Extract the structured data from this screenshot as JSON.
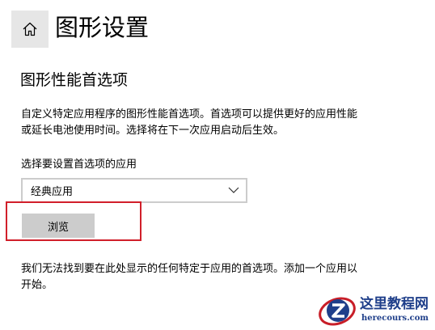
{
  "header": {
    "home_icon": "home-icon",
    "title": "图形设置"
  },
  "section": {
    "heading": "图形性能首选项",
    "description_lines": [
      "自定义特定应用程序的图形性能首选项。首选项可以提供更好的应用性能",
      "或延长电池使用时间。选择将在下一次应用启动后生效。"
    ]
  },
  "app_picker": {
    "label": "选择要设置首选项的应用",
    "selected": "经典应用",
    "chevron_icon": "chevron-down-icon"
  },
  "browse_button": {
    "label": "浏览"
  },
  "empty_message_lines": [
    "我们无法找到要在此处显示的任何特定于应用的首选项。添加一个应用以",
    "开始。"
  ],
  "watermark": {
    "name": "这里教程网",
    "url": "herecours.com"
  },
  "colors": {
    "highlight_border": "#d11f2a",
    "button_bg": "#cccccc",
    "home_bg": "#e6e6e6",
    "watermark_blue": "#1f3f8a"
  }
}
